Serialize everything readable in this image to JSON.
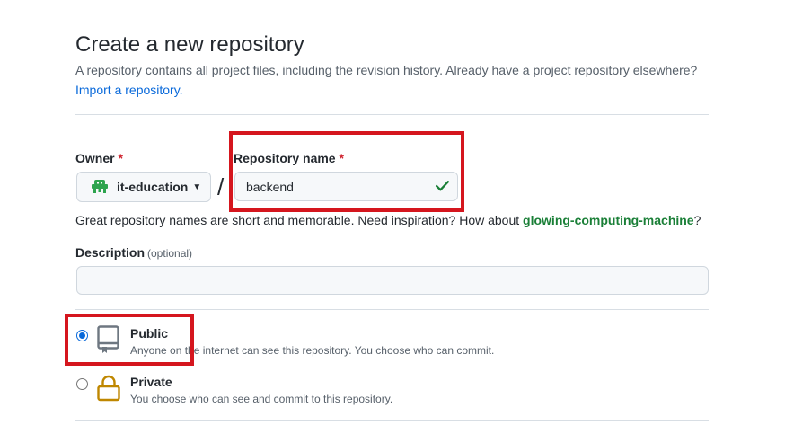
{
  "header": {
    "title": "Create a new repository",
    "subtitle": "A repository contains all project files, including the revision history. Already have a project repository elsewhere?",
    "import_link": "Import a repository."
  },
  "owner": {
    "label": "Owner",
    "required_mark": "*",
    "value": "it-education",
    "avatar_icon": "space-invader-icon"
  },
  "separator": "/",
  "repo_name": {
    "label": "Repository name",
    "required_mark": "*",
    "value": "backend",
    "valid_icon": "check-icon"
  },
  "name_hint": {
    "text": "Great repository names are short and memorable. Need inspiration? How about ",
    "suggestion": "glowing-computing-machine",
    "end": "?"
  },
  "description": {
    "label": "Description",
    "optional": "(optional)",
    "value": ""
  },
  "visibility": {
    "options": [
      {
        "title": "Public",
        "description": "Anyone on the internet can see this repository. You choose who can commit.",
        "selected": true,
        "icon": "repo-icon"
      },
      {
        "title": "Private",
        "description": "You choose who can see and commit to this repository.",
        "selected": false,
        "icon": "lock-icon"
      }
    ]
  },
  "colors": {
    "accent": "#0969da",
    "success": "#1a7f37",
    "required": "#cf222e",
    "highlight": "#d5161e"
  }
}
